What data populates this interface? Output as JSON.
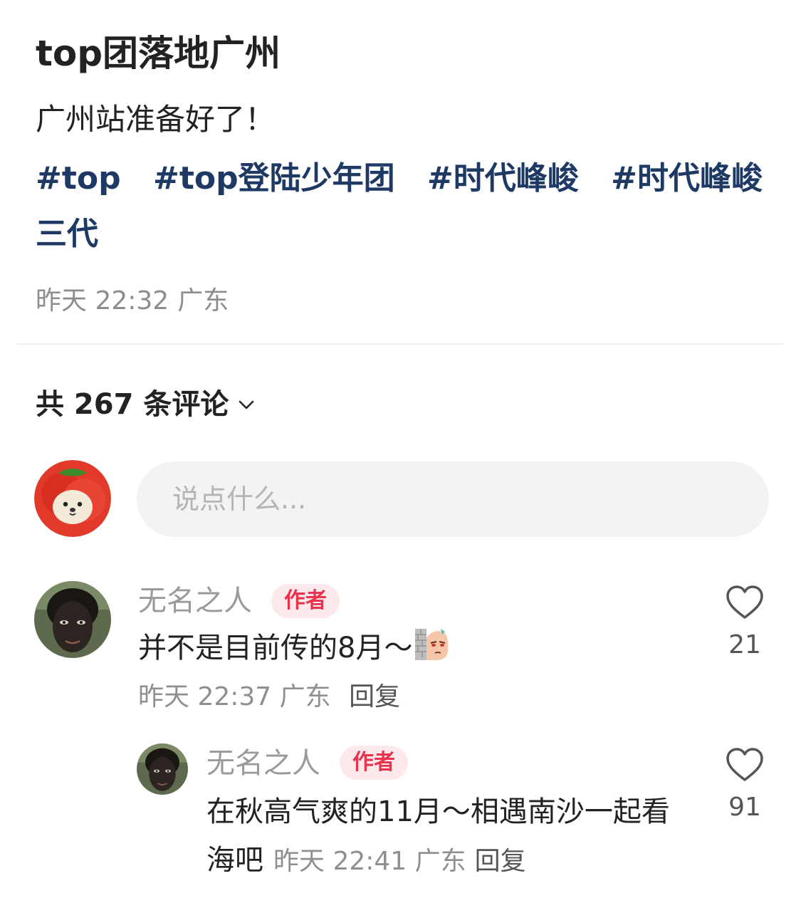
{
  "post": {
    "title": "top团落地广州",
    "body": "广州站准备好了！",
    "tags": [
      "#top",
      "#top登陆少年团",
      "#时代峰峻",
      "#时代峰峻三代"
    ],
    "time": "昨天 22:32",
    "location": "广东"
  },
  "comments_header": {
    "label": "共 267 条评论"
  },
  "composer": {
    "placeholder": "说点什么..."
  },
  "comments": [
    {
      "author": "无名之人",
      "badge": "作者",
      "text": "并不是目前传的8月～",
      "time": "昨天 22:37",
      "location": "广东",
      "reply_label": "回复",
      "likes": "21"
    }
  ],
  "replies": [
    {
      "author": "无名之人",
      "badge": "作者",
      "text": "在秋高气爽的11月～相遇南沙一起看海吧",
      "time": "昨天 22:41",
      "location": "广东",
      "reply_label": "回复",
      "likes": "91"
    }
  ],
  "colors": {
    "tag": "#1e3a64",
    "badge_text": "#e8334f",
    "badge_bg": "#fde9ec",
    "meta": "#8f8f8f"
  }
}
